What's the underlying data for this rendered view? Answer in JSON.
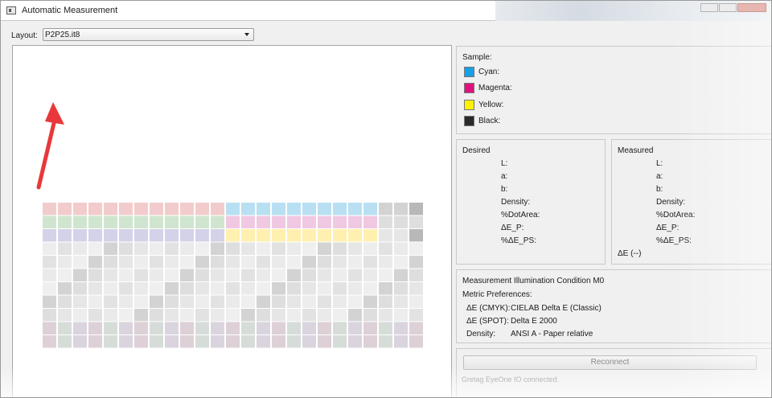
{
  "window": {
    "title": "Automatic Measurement"
  },
  "layout": {
    "label": "Layout:",
    "selected": "P2P25.it8"
  },
  "sample": {
    "title": "Sample:",
    "items": [
      {
        "label": "Cyan:",
        "color": "#1aa0e6"
      },
      {
        "label": "Magenta:",
        "color": "#e0117f"
      },
      {
        "label": "Yellow:",
        "color": "#fff200"
      },
      {
        "label": "Black:",
        "color": "#2a2a2a"
      }
    ]
  },
  "desired": {
    "title": "Desired",
    "fields": [
      "L:",
      "a:",
      "b:",
      "Density:",
      "%DotArea:",
      "ΔE_P:",
      "%ΔE_PS:"
    ]
  },
  "measured": {
    "title": "Measured",
    "fields": [
      "L:",
      "a:",
      "b:",
      "Density:",
      "%DotArea:",
      "ΔE_P:",
      "%ΔE_PS:"
    ],
    "delta_e": "ΔE (--)"
  },
  "info": {
    "condition": "Measurement Illumination Condition M0",
    "prefs_title": "Metric Preferences:",
    "rows": [
      {
        "key": "ΔE (CMYK):",
        "value": "CIELAB Delta E (Classic)"
      },
      {
        "key": "ΔE (SPOT):",
        "value": "Delta E 2000"
      },
      {
        "key": "Density:",
        "value": "ANSI A - Paper relative"
      }
    ]
  },
  "reconnect": {
    "label": "Reconnect"
  },
  "status": "Gretag EyeOne IO connected.",
  "icons": {
    "app": "app-window-icon",
    "minimize": "minimize-icon",
    "maximize": "maximize-icon",
    "close": "close-icon",
    "dropdown": "chevron-down-icon",
    "annotation": "red-arrow-icon"
  },
  "patch_chart": {
    "columns": 25,
    "rows": 11,
    "top_rows_left": [
      "#f2cccc",
      "#cfe5cf",
      "#d4d2e8"
    ],
    "top_rows_right": [
      "#b8e0f2",
      "#f0c8e2",
      "#fff0b0"
    ],
    "neutral_rows": [
      "#d3d3d3",
      "#dedede",
      "#e6e6e6",
      "#ededed",
      "#e2e2e2",
      "#eaeaea",
      "#efefef"
    ],
    "bottom_row": [
      "#ddd0d6",
      "#d6dcd8",
      "#dad4de"
    ],
    "dark_side": "#b8b8b8"
  }
}
